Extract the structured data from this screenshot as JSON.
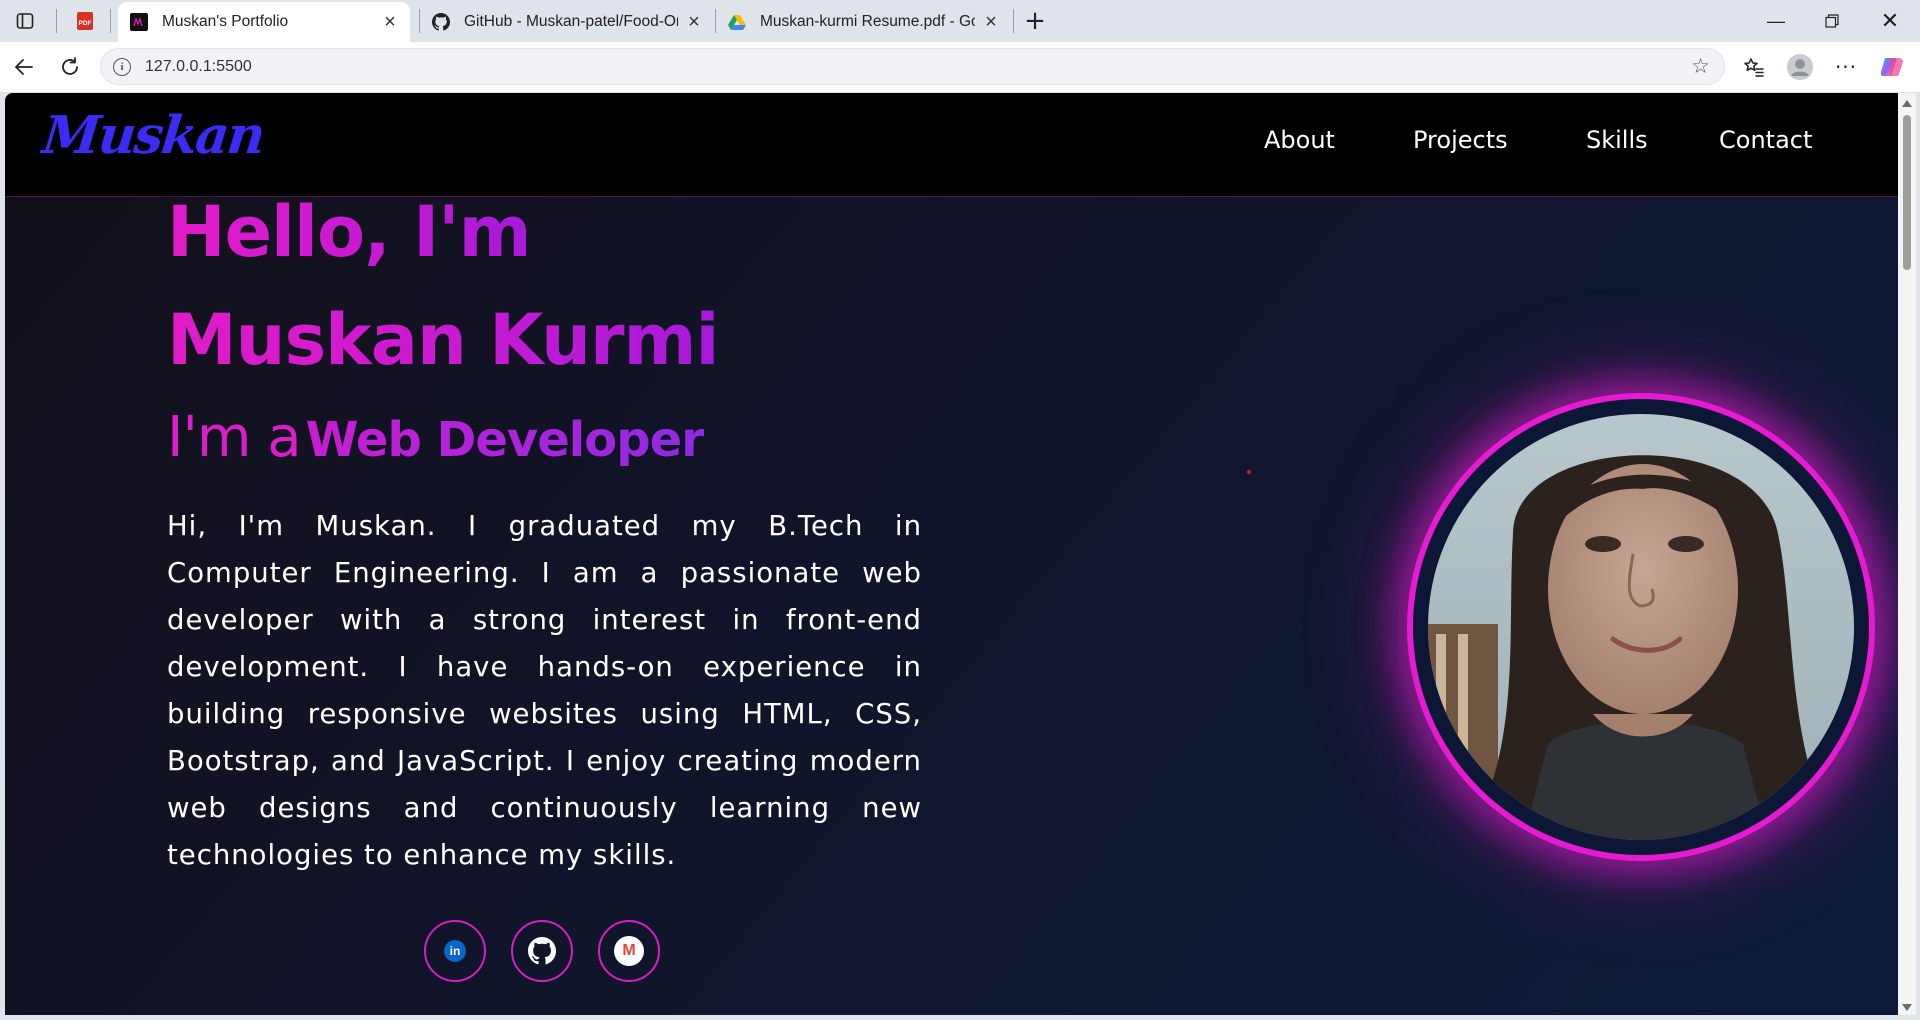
{
  "browser": {
    "tabs": [
      {
        "title": "Muskan's Portfolio",
        "active": true
      },
      {
        "title": "GitHub - Muskan-patel/Food-Ord",
        "active": false
      },
      {
        "title": "Muskan-kurmi Resume.pdf - Goo",
        "active": false
      }
    ],
    "url": "127.0.0.1:5500",
    "pdf_tab_badge": "PDF"
  },
  "site": {
    "logo": "Muskan",
    "nav": [
      "About",
      "Projects",
      "Skills",
      "Contact"
    ],
    "hero": {
      "greeting": "Hello, I'm",
      "name": "Muskan Kurmi",
      "subtitle_prefix": "I'm a",
      "role": "Web Developer",
      "bio": "Hi, I'm Muskan. I graduated my B.Tech in Computer Engineering. I am a passionate web developer with a strong interest in front-end development. I have hands-on experience in building responsive websites using HTML, CSS, Bootstrap, and JavaScript. I enjoy creating modern web designs and continuously learning new technologies to enhance my skills."
    },
    "social": [
      {
        "icon": "linkedin-icon",
        "label": "in"
      },
      {
        "icon": "github-icon",
        "label": ""
      },
      {
        "icon": "gmail-icon",
        "label": "M"
      }
    ]
  },
  "colors": {
    "accent_pink": "#e21bc8",
    "logo_blue": "#3a2bf5",
    "nav_bg": "#000000"
  }
}
